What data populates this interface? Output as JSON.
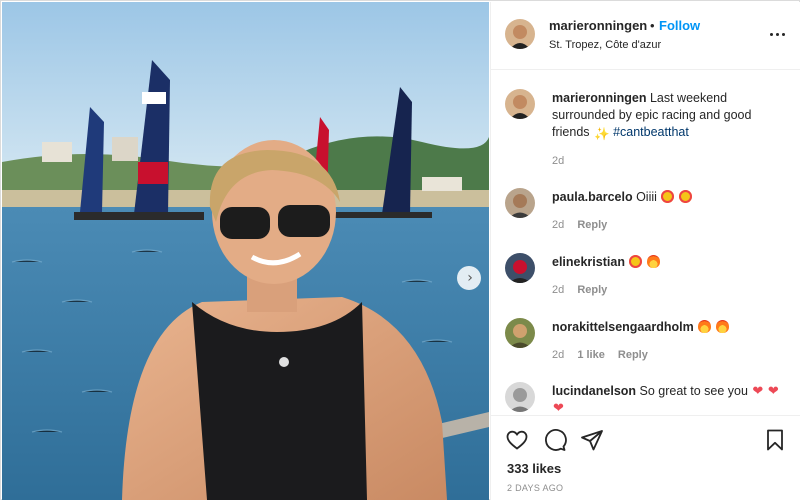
{
  "post": {
    "username": "marieronningen",
    "separator": "•",
    "follow_label": "Follow",
    "location": "St. Tropez, Côte d'azur",
    "more_icon": "more-options-icon",
    "next_icon": "chevron-right-icon",
    "likes": "333 likes",
    "date": "2 DAYS AGO"
  },
  "caption": {
    "username": "marieronningen",
    "text": "Last weekend surrounded by epic racing and good friends",
    "hashtag": "#cantbeatthat",
    "time": "2d"
  },
  "comments": [
    {
      "username": "paula.barcelo",
      "text": "Oiiii",
      "emoji": [
        "star-struck",
        "star-struck"
      ],
      "time": "2d",
      "likes": "",
      "reply": "Reply"
    },
    {
      "username": "elinekristian",
      "text": "",
      "emoji": [
        "star-struck",
        "fire"
      ],
      "time": "2d",
      "likes": "",
      "reply": "Reply"
    },
    {
      "username": "norakittelsengaardholm",
      "text": "",
      "emoji": [
        "fire",
        "fire"
      ],
      "time": "2d",
      "likes": "1 like",
      "reply": "Reply"
    },
    {
      "username": "lucindanelson",
      "text": "So great to see you",
      "emoji": [
        "heart",
        "heart",
        "heart"
      ],
      "time": "",
      "likes": "",
      "reply": ""
    }
  ],
  "actions": {
    "like_icon": "heart-outline-icon",
    "comment_icon": "comment-icon",
    "share_icon": "share-icon",
    "save_icon": "bookmark-icon"
  },
  "colors": {
    "link_blue": "#0095f6",
    "hashtag": "#00376b",
    "muted": "#8e8e8e",
    "heart_red": "#ed4956"
  }
}
